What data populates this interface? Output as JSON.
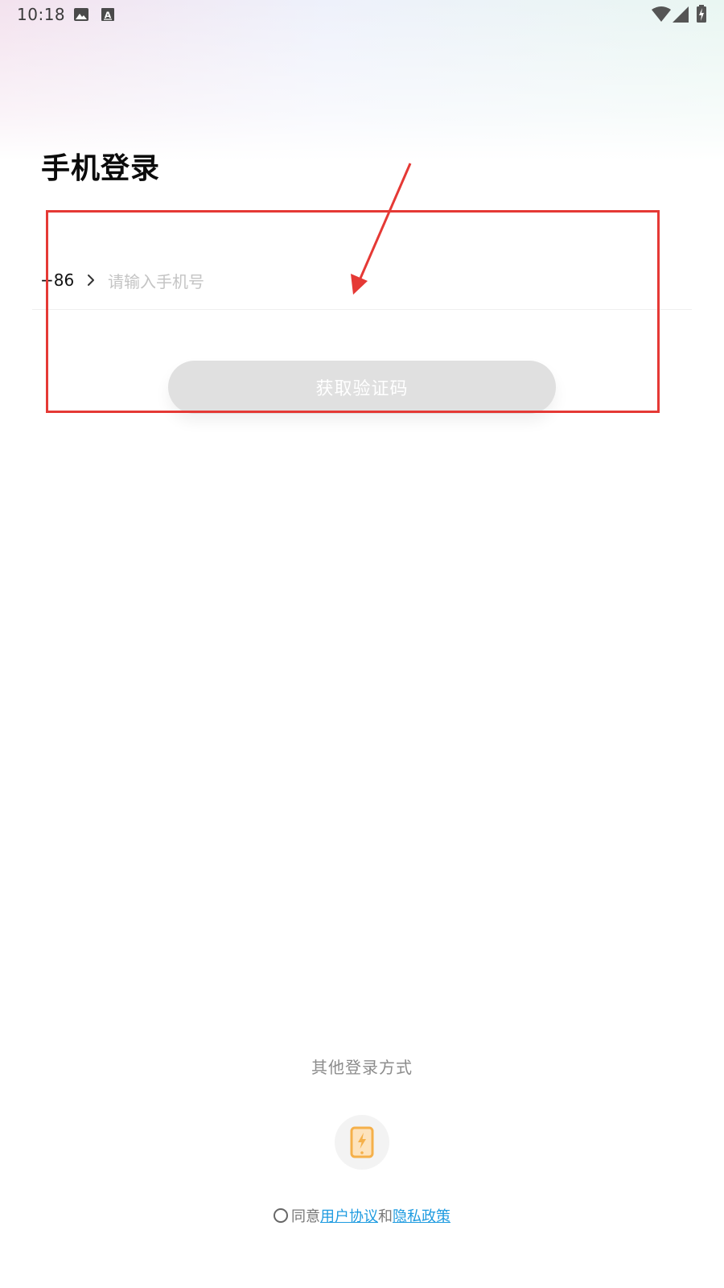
{
  "status_bar": {
    "time": "10:18",
    "icons": [
      "image-icon",
      "font-icon",
      "wifi-icon",
      "signal-icon",
      "battery-icon"
    ]
  },
  "title": "手机登录",
  "phone": {
    "country_code": "+86",
    "placeholder": "请输入手机号",
    "value": ""
  },
  "get_code_button": "获取验证码",
  "other_login": {
    "label": "其他登录方式",
    "icon": "phone-flash-icon"
  },
  "agreement": {
    "prefix": "同意",
    "user_agreement": "用户协议",
    "conjunction": "和",
    "privacy_policy": "隐私政策"
  },
  "colors": {
    "annotation": "#e53935",
    "button_disabled": "#e0e0e0",
    "link": "#1e9be0",
    "icon_accent": "#f5b04a"
  }
}
